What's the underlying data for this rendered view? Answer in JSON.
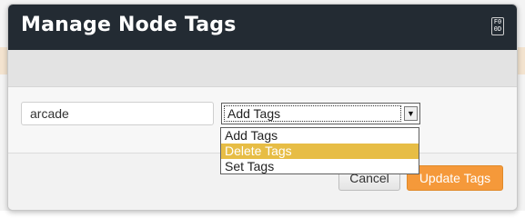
{
  "dialog": {
    "title": "Manage Node Tags",
    "close_glyph_top": "F0",
    "close_glyph_bottom": "0D"
  },
  "form": {
    "tag_input_value": "arcade",
    "action_select": {
      "selected": "Add Tags",
      "options": [
        "Add Tags",
        "Delete Tags",
        "Set Tags"
      ],
      "highlighted": "Delete Tags"
    }
  },
  "footer": {
    "cancel_label": "Cancel",
    "update_label": "Update Tags"
  },
  "colors": {
    "titlebar": "#232b33",
    "primary_button": "#f5993a",
    "option_highlight": "#e7bd45"
  }
}
